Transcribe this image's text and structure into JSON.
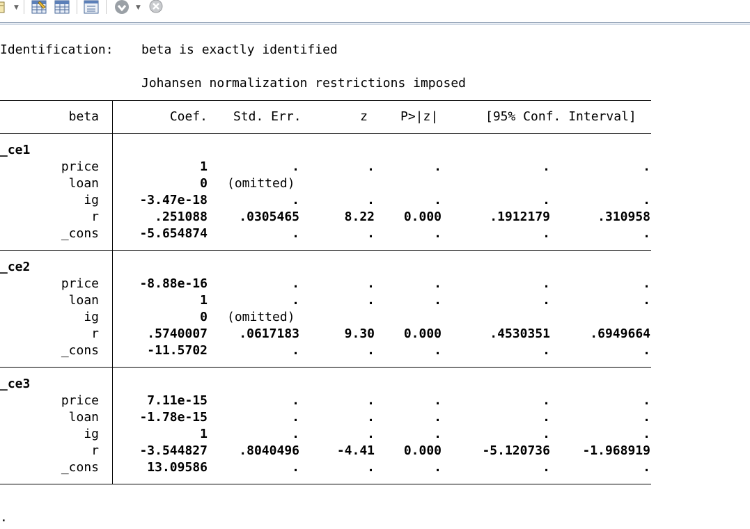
{
  "toolbar": {
    "buttons": [
      {
        "name": "edit-icon"
      },
      {
        "name": "data-editor-icon"
      },
      {
        "name": "data-browser-icon"
      },
      {
        "name": "variables-manager-icon"
      },
      {
        "name": "more-icon"
      },
      {
        "name": "break-icon"
      }
    ]
  },
  "output": {
    "identification_label": "Identification:",
    "identification_text": "beta is exactly identified",
    "restriction_text": "Johansen normalization restrictions imposed",
    "headers": {
      "beta": "beta",
      "coef": "Coef.",
      "stderr": "Std. Err.",
      "z": "z",
      "p": "P>|z|",
      "ci": "[95% Conf. Interval]"
    },
    "groups": [
      {
        "name": "_ce1",
        "rows": [
          {
            "var": "price",
            "coef": "1",
            "se": ".",
            "z": ".",
            "p": ".",
            "lo": ".",
            "hi": "."
          },
          {
            "var": "loan",
            "coef": "0",
            "se": "(omitted)",
            "z": "",
            "p": "",
            "lo": "",
            "hi": ""
          },
          {
            "var": "ig",
            "coef": "-3.47e-18",
            "se": ".",
            "z": ".",
            "p": ".",
            "lo": ".",
            "hi": "."
          },
          {
            "var": "r",
            "coef": ".251088",
            "se": ".0305465",
            "z": "8.22",
            "p": "0.000",
            "lo": ".1912179",
            "hi": ".310958"
          },
          {
            "var": "_cons",
            "coef": "-5.654874",
            "se": ".",
            "z": ".",
            "p": ".",
            "lo": ".",
            "hi": "."
          }
        ]
      },
      {
        "name": "_ce2",
        "rows": [
          {
            "var": "price",
            "coef": "-8.88e-16",
            "se": ".",
            "z": ".",
            "p": ".",
            "lo": ".",
            "hi": "."
          },
          {
            "var": "loan",
            "coef": "1",
            "se": ".",
            "z": ".",
            "p": ".",
            "lo": ".",
            "hi": "."
          },
          {
            "var": "ig",
            "coef": "0",
            "se": "(omitted)",
            "z": "",
            "p": "",
            "lo": "",
            "hi": ""
          },
          {
            "var": "r",
            "coef": ".5740007",
            "se": ".0617183",
            "z": "9.30",
            "p": "0.000",
            "lo": ".4530351",
            "hi": ".6949664"
          },
          {
            "var": "_cons",
            "coef": "-11.5702",
            "se": ".",
            "z": ".",
            "p": ".",
            "lo": ".",
            "hi": "."
          }
        ]
      },
      {
        "name": "_ce3",
        "rows": [
          {
            "var": "price",
            "coef": "7.11e-15",
            "se": ".",
            "z": ".",
            "p": ".",
            "lo": ".",
            "hi": "."
          },
          {
            "var": "loan",
            "coef": "-1.78e-15",
            "se": ".",
            "z": ".",
            "p": ".",
            "lo": ".",
            "hi": "."
          },
          {
            "var": "ig",
            "coef": "1",
            "se": ".",
            "z": ".",
            "p": ".",
            "lo": ".",
            "hi": "."
          },
          {
            "var": "r",
            "coef": "-3.544827",
            "se": ".8040496",
            "z": "-4.41",
            "p": "0.000",
            "lo": "-5.120736",
            "hi": "-1.968919"
          },
          {
            "var": "_cons",
            "coef": "13.09586",
            "se": ".",
            "z": ".",
            "p": ".",
            "lo": ".",
            "hi": "."
          }
        ]
      }
    ],
    "trailing_prompt": "."
  }
}
